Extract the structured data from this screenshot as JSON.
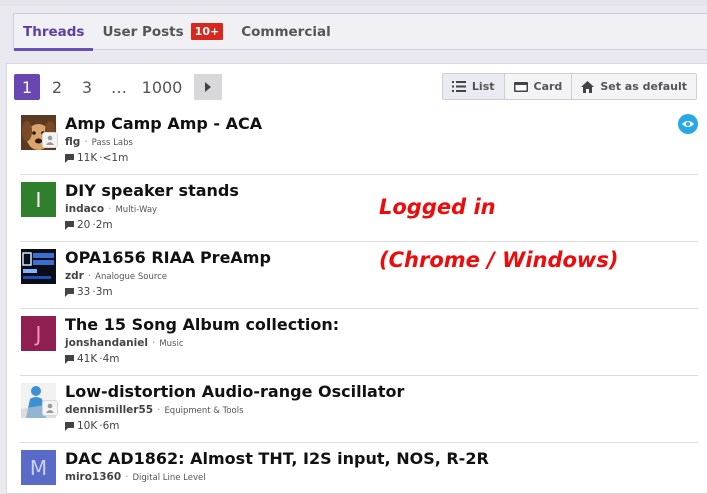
{
  "tabs": [
    {
      "label": "Threads",
      "active": true
    },
    {
      "label": "User Posts",
      "badge": "10+"
    },
    {
      "label": "Commercial"
    }
  ],
  "pagination": {
    "pages": [
      "1",
      "2",
      "3",
      "…",
      "1000"
    ],
    "current": "1",
    "next_icon": "chevron-right-icon"
  },
  "view_switch": {
    "list_label": "List",
    "card_label": "Card",
    "default_label": "Set as default"
  },
  "threads": [
    {
      "title": "Amp Camp Amp - ACA",
      "author": "flg",
      "forum": "Pass Labs",
      "replies": "11K",
      "age": "<1m",
      "avatar": "photo-dog",
      "watched": true
    },
    {
      "title": "DIY speaker stands",
      "author": "indaco",
      "forum": "Multi-Way",
      "replies": "20",
      "age": "2m",
      "avatar_letter": "I",
      "avatar_color": "#2f7f2c"
    },
    {
      "title": "OPA1656 RIAA PreAmp",
      "author": "zdr",
      "forum": "Analogue Source",
      "replies": "33",
      "age": "3m",
      "avatar": "photo-display"
    },
    {
      "title": "The 15 Song Album collection:",
      "author": "jonshandaniel",
      "forum": "Music",
      "replies": "41K",
      "age": "4m",
      "avatar_letter": "J",
      "avatar_color": "#8f1f4f"
    },
    {
      "title": "Low-distortion Audio-range Oscillator",
      "author": "dennismiller55",
      "forum": "Equipment & Tools",
      "replies": "10K",
      "age": "6m",
      "avatar": "default-person"
    },
    {
      "title": "DAC AD1862: Almost THT, I2S input, NOS, R-2R",
      "author": "miro1360",
      "forum": "Digital Line Level",
      "replies": "",
      "age": "",
      "avatar_letter": "M",
      "avatar_color": "#5a6bc7"
    }
  ],
  "overlay_text": {
    "line1": "Logged in",
    "line2": "(Chrome / Windows)"
  },
  "colors": {
    "accent": "#6a46b0",
    "badge": "#d9271e",
    "watch": "#29a8e6",
    "overlay": "#ee0b0b"
  }
}
